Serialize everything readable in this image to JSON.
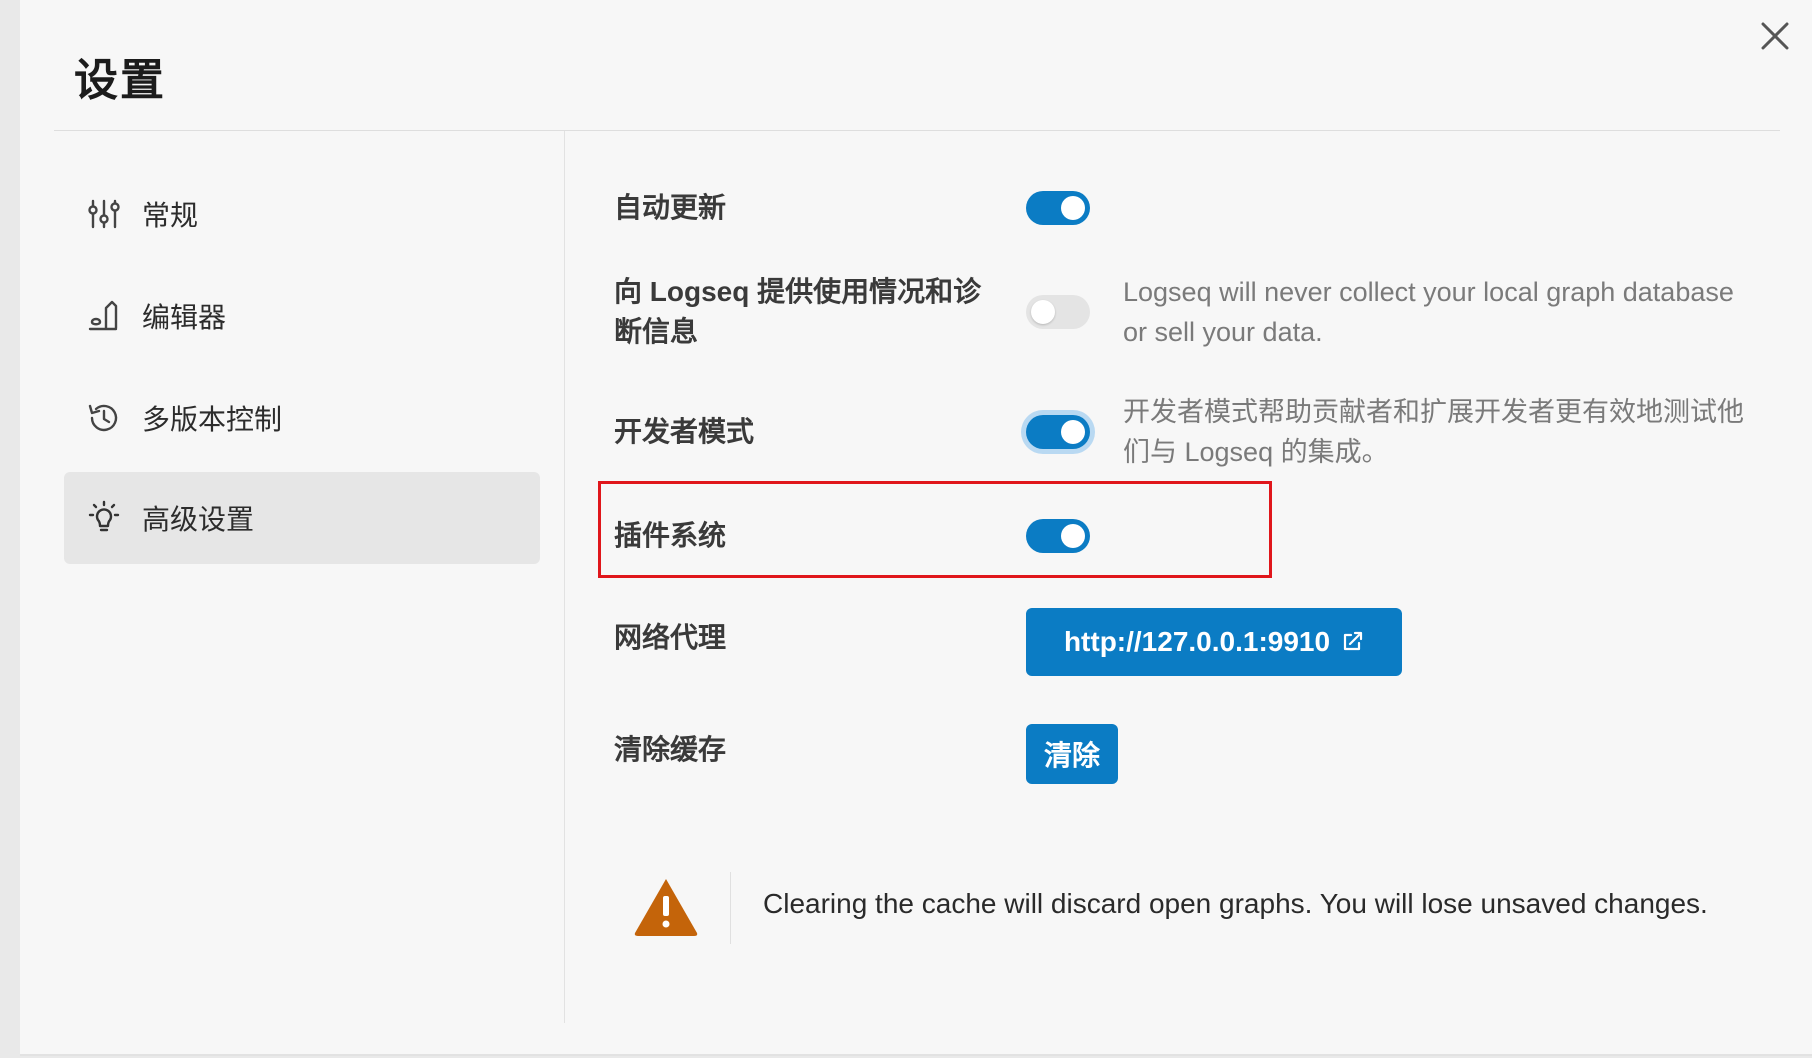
{
  "dialog": {
    "title": "设置"
  },
  "sidebar": {
    "items": [
      {
        "label": "常规",
        "icon": "sliders-icon",
        "active": false
      },
      {
        "label": "编辑器",
        "icon": "editor-icon",
        "active": false
      },
      {
        "label": "多版本控制",
        "icon": "history-icon",
        "active": false
      },
      {
        "label": "高级设置",
        "icon": "bulb-icon",
        "active": true
      }
    ]
  },
  "settings": {
    "auto_update": {
      "label": "自动更新",
      "enabled": true
    },
    "telemetry": {
      "label_line1": "向 Logseq 提供使用情况和诊",
      "label_line2": "断信息",
      "enabled": false,
      "desc_line1": "Logseq will never collect your local graph database",
      "desc_line2": "or sell your data."
    },
    "developer_mode": {
      "label": "开发者模式",
      "enabled": true,
      "desc_line1": "开发者模式帮助贡献者和扩展开发者更有效地测试他",
      "desc_line2": "们与 Logseq 的集成。"
    },
    "plugin_system": {
      "label": "插件系统",
      "enabled": true
    },
    "network_proxy": {
      "label": "网络代理",
      "value": "http://127.0.0.1:9910"
    },
    "clear_cache": {
      "label": "清除缓存",
      "button": "清除"
    }
  },
  "warning": {
    "text": "Clearing the cache will discard open graphs. You will lose unsaved changes."
  },
  "colors": {
    "accent": "#0b7cc4",
    "highlight": "#e0161b",
    "warning": "#c4640a"
  }
}
